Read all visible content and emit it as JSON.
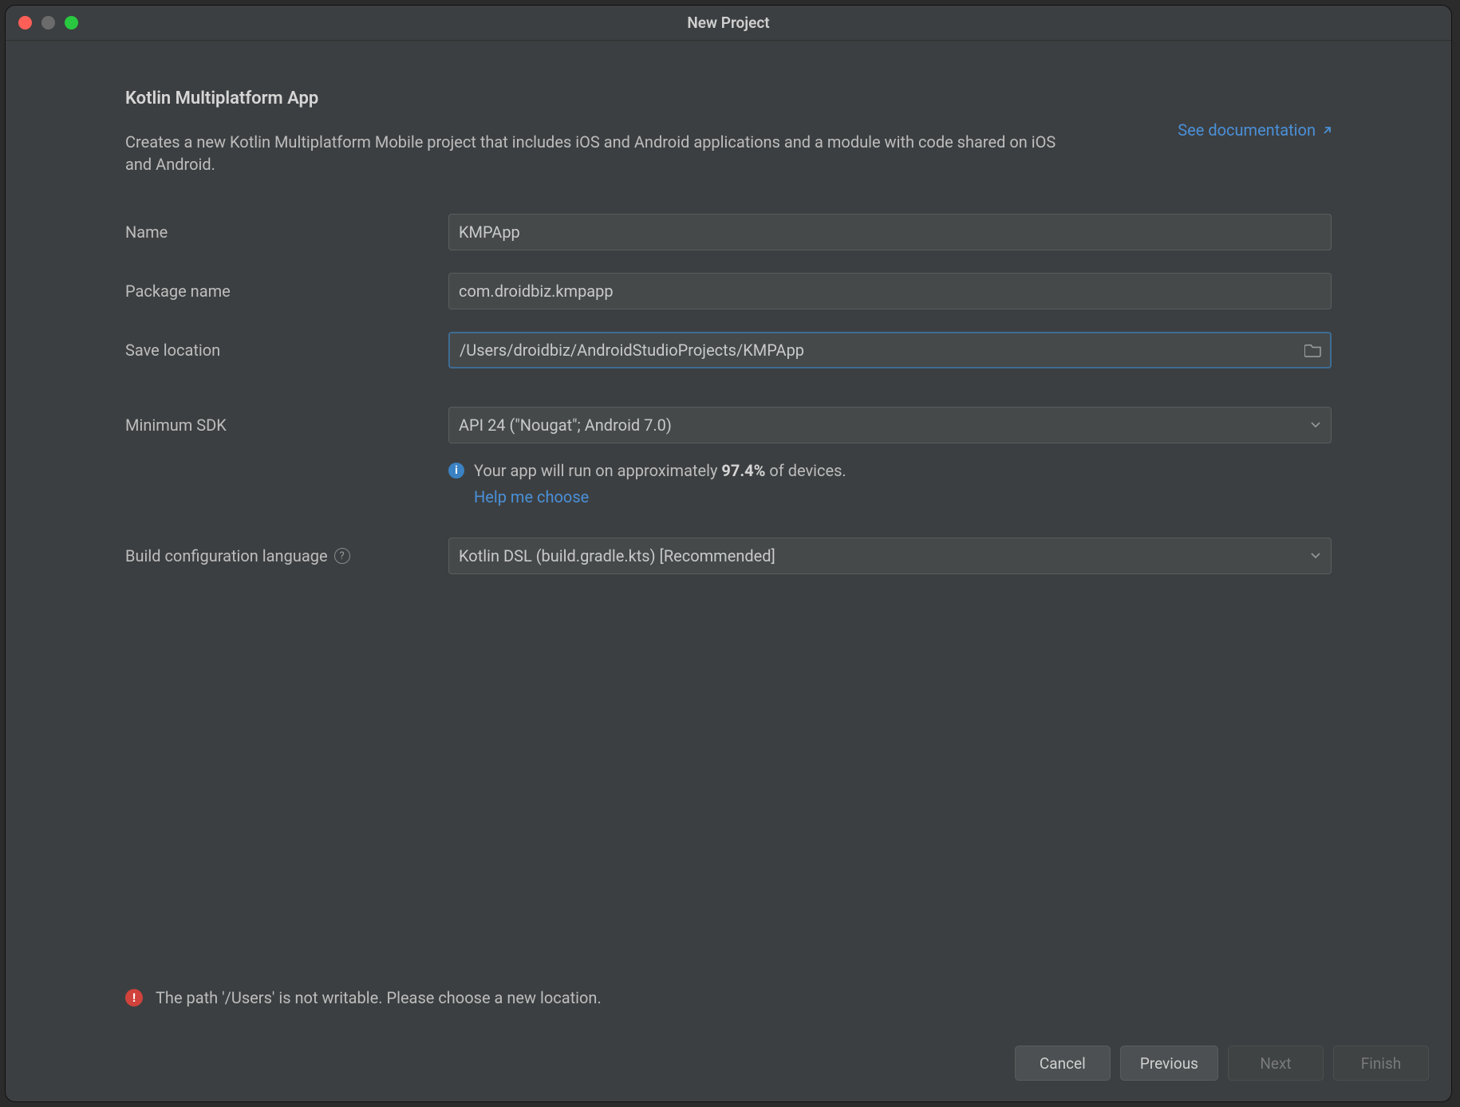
{
  "window": {
    "title": "New Project"
  },
  "header": {
    "title": "Kotlin Multiplatform App",
    "description": "Creates a new Kotlin Multiplatform Mobile project that includes iOS and Android applications and a module with code shared on iOS and Android.",
    "doc_link": "See documentation"
  },
  "form": {
    "name": {
      "label": "Name",
      "value": "KMPApp"
    },
    "package": {
      "label": "Package name",
      "value": "com.droidbiz.kmpapp"
    },
    "location": {
      "label": "Save location",
      "value": "/Users/droidbiz/AndroidStudioProjects/KMPApp"
    },
    "min_sdk": {
      "label": "Minimum SDK",
      "value": "API 24 (\"Nougat\"; Android 7.0)"
    },
    "build_lang": {
      "label": "Build configuration language",
      "value": "Kotlin DSL (build.gradle.kts) [Recommended]"
    }
  },
  "info": {
    "text_prefix": "Your app will run on approximately ",
    "percent": "97.4%",
    "text_suffix": " of devices.",
    "help_link": "Help me choose"
  },
  "error": {
    "text": "The path '/Users' is not writable. Please choose a new location."
  },
  "footer": {
    "cancel": "Cancel",
    "previous": "Previous",
    "next": "Next",
    "finish": "Finish"
  }
}
